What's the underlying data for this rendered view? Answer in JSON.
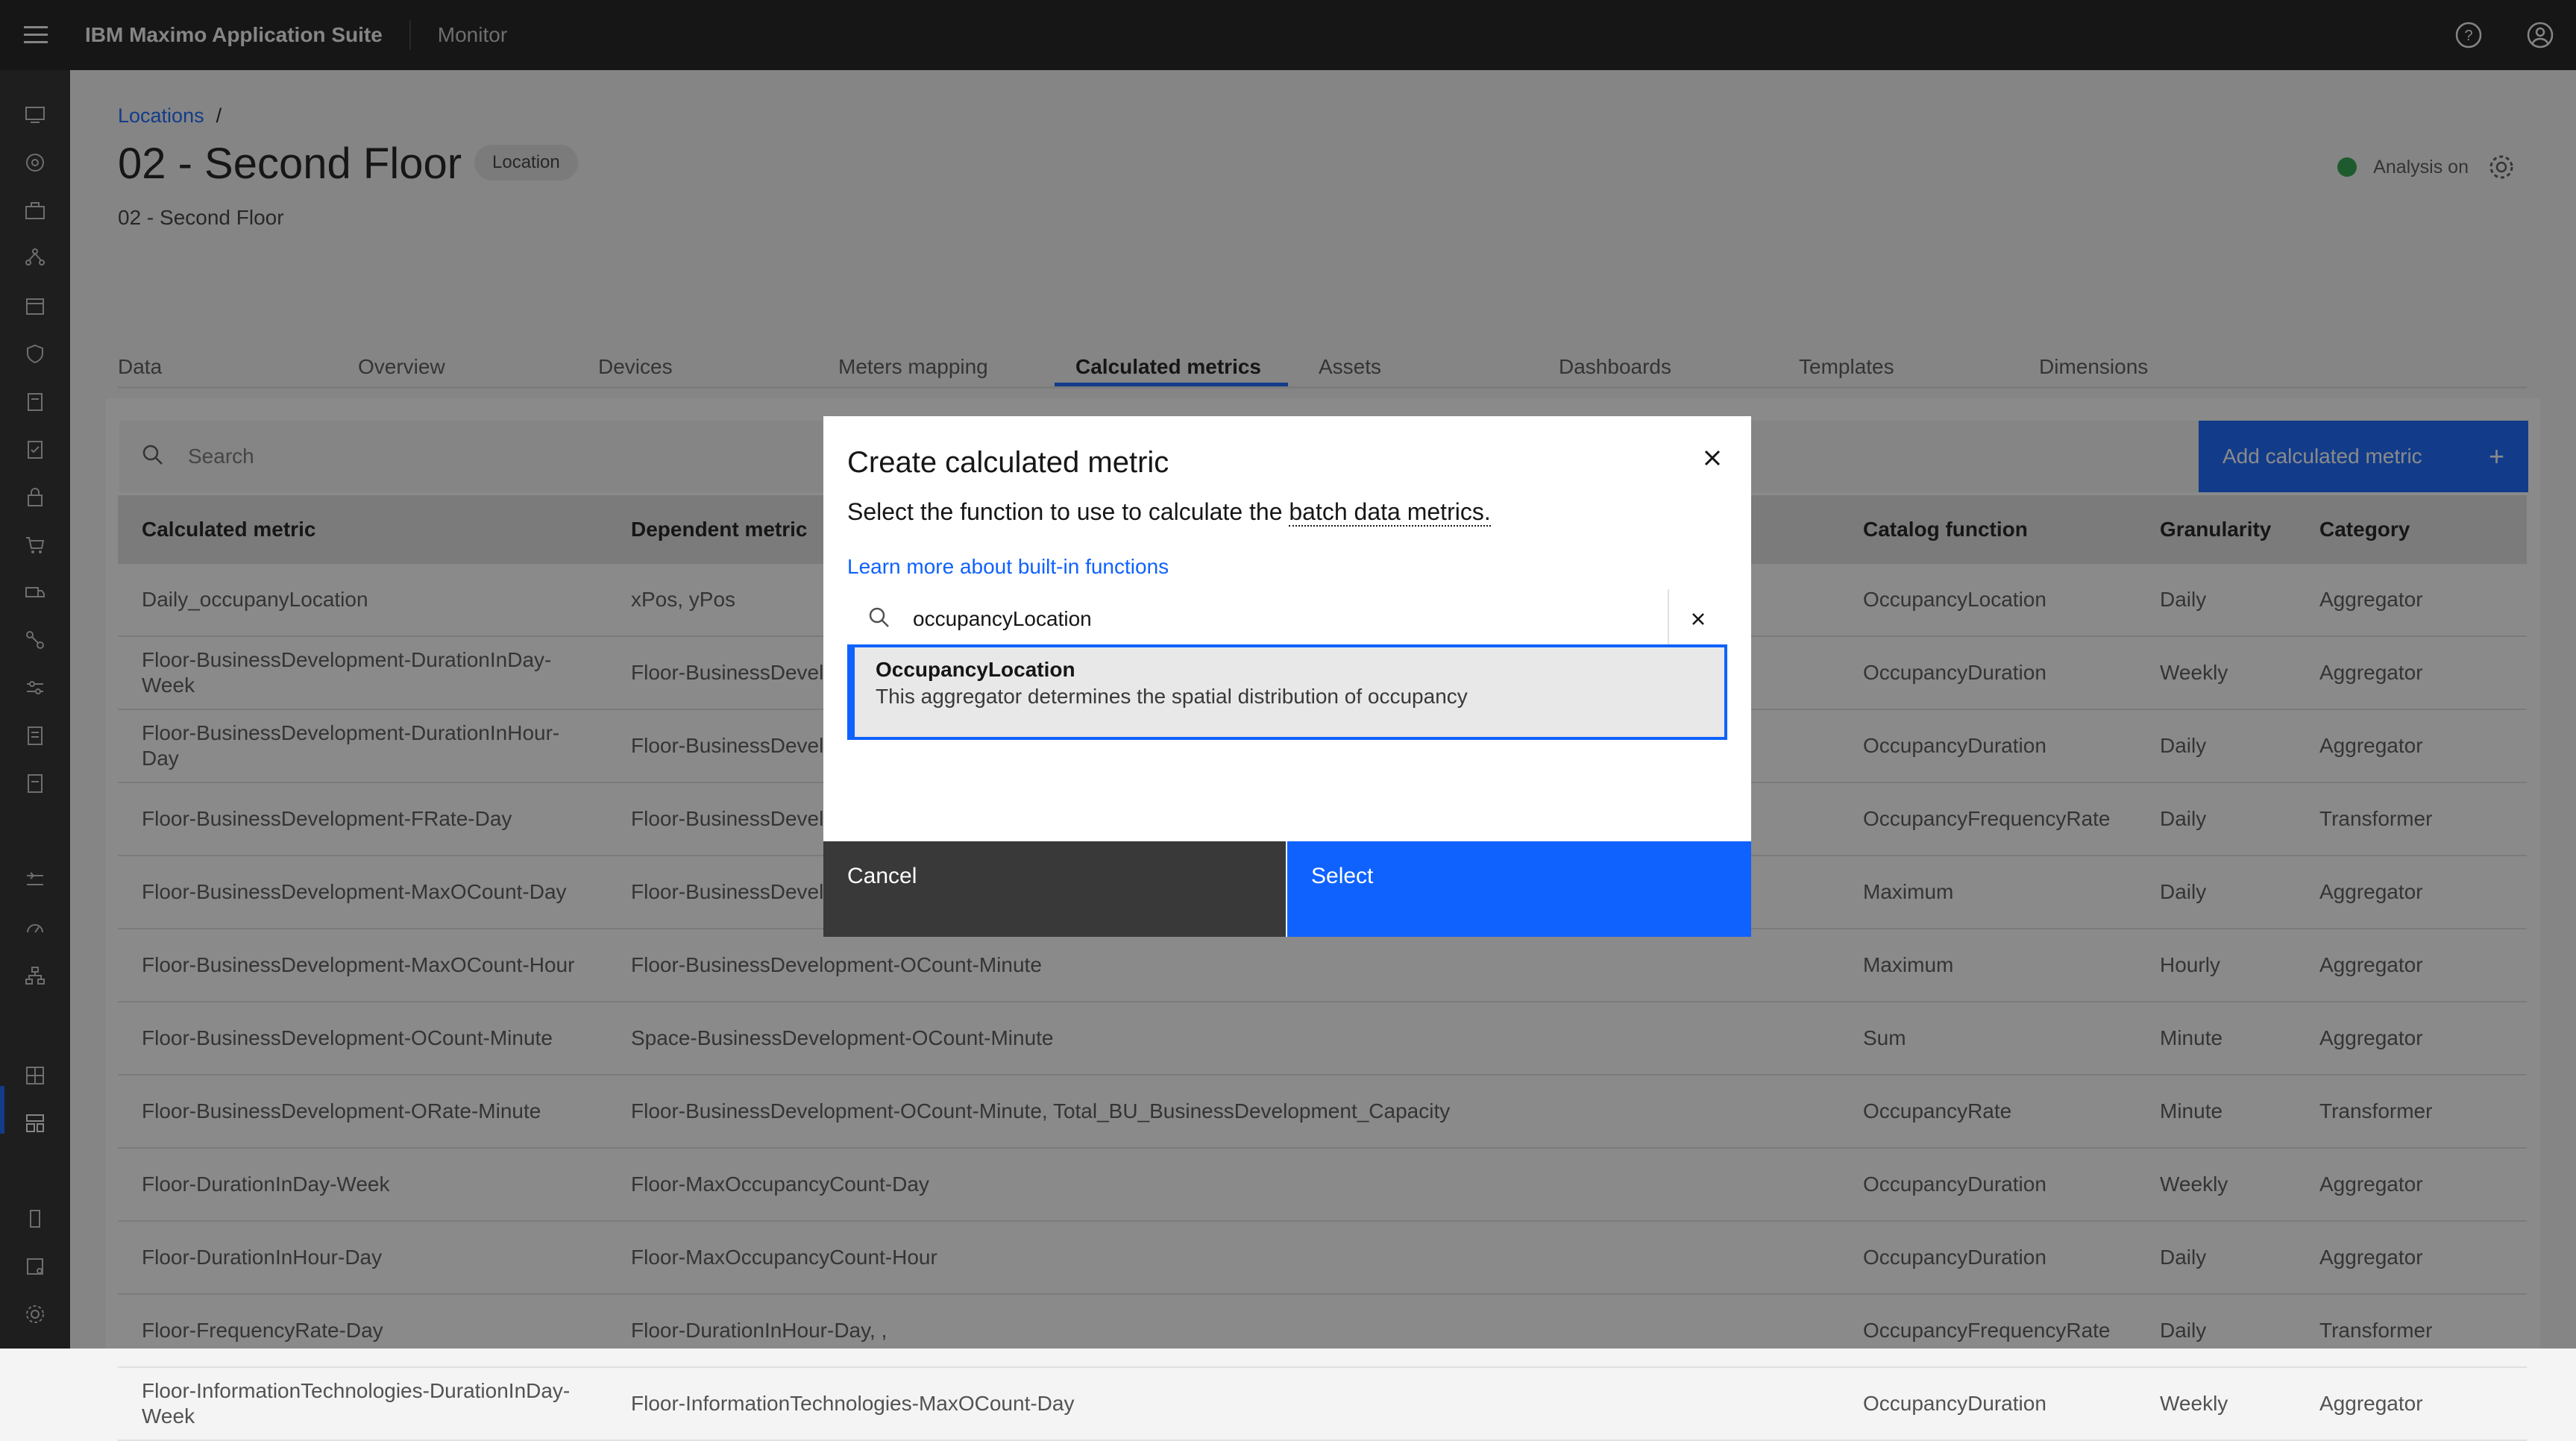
{
  "header": {
    "brand": "IBM Maximo Application Suite",
    "product": "Monitor",
    "icons": [
      "hamburger-menu-icon",
      "help-icon",
      "user-avatar-icon"
    ]
  },
  "sidebar": {
    "icons": [
      "monitor-icon",
      "asset-icon",
      "toolbox-icon",
      "network-icon",
      "calendar-icon",
      "shield-icon",
      "clipboard-icon",
      "checklist-icon",
      "lock-icon",
      "cart-icon",
      "truck-icon",
      "connection-icon",
      "sliders-icon",
      "report-icon",
      "document-icon",
      "settings-adjust-icon",
      "gauge-icon",
      "hierarchy-icon",
      "grid-icon",
      "layout-icon",
      "mobile-icon",
      "tablet-icon",
      "settings-icon"
    ]
  },
  "page": {
    "breadcrumb": "Locations",
    "breadcrumb_sep": "/",
    "title": "02 - Second Floor",
    "tag": "Location",
    "subtitle": "02 - Second Floor",
    "analysis_label": "Analysis on",
    "analysis_color": "#24a148"
  },
  "tabs": [
    "Data",
    "Overview",
    "Devices",
    "Meters mapping",
    "Calculated metrics",
    "Assets",
    "Dashboards",
    "Templates",
    "Dimensions"
  ],
  "active_tab": "Calculated metrics",
  "toolbar": {
    "search_placeholder": "Search",
    "add_label": "Add calculated metric",
    "add_icon": "+"
  },
  "table": {
    "headers": [
      "Calculated metric",
      "Dependent metric",
      "Catalog function",
      "Granularity",
      "Category"
    ],
    "rows": [
      [
        "Daily_occupanyLocation",
        "xPos, yPos",
        "OccupancyLocation",
        "Daily",
        "Aggregator"
      ],
      [
        "Floor-BusinessDevelopment-DurationInDay-Week",
        "Floor-BusinessDevelopment-MaxOCount-Day",
        "OccupancyDuration",
        "Weekly",
        "Aggregator"
      ],
      [
        "Floor-BusinessDevelopment-DurationInHour-Day",
        "Floor-BusinessDevelopment-MaxOCount-Hour",
        "OccupancyDuration",
        "Daily",
        "Aggregator"
      ],
      [
        "Floor-BusinessDevelopment-FRate-Day",
        "Floor-BusinessDevelopment-DurationInHour-Day",
        "OccupancyFrequencyRate",
        "Daily",
        "Transformer"
      ],
      [
        "Floor-BusinessDevelopment-MaxOCount-Day",
        "Floor-BusinessDevelopment-OCount-Minute",
        "Maximum",
        "Daily",
        "Aggregator"
      ],
      [
        "Floor-BusinessDevelopment-MaxOCount-Hour",
        "Floor-BusinessDevelopment-OCount-Minute",
        "Maximum",
        "Hourly",
        "Aggregator"
      ],
      [
        "Floor-BusinessDevelopment-OCount-Minute",
        "Space-BusinessDevelopment-OCount-Minute",
        "Sum",
        "Minute",
        "Aggregator"
      ],
      [
        "Floor-BusinessDevelopment-ORate-Minute",
        "Floor-BusinessDevelopment-OCount-Minute, Total_BU_BusinessDevelopment_Capacity",
        "OccupancyRate",
        "Minute",
        "Transformer"
      ],
      [
        "Floor-DurationInDay-Week",
        "Floor-MaxOccupancyCount-Day",
        "OccupancyDuration",
        "Weekly",
        "Aggregator"
      ],
      [
        "Floor-DurationInHour-Day",
        "Floor-MaxOccupancyCount-Hour",
        "OccupancyDuration",
        "Daily",
        "Aggregator"
      ],
      [
        "Floor-FrequencyRate-Day",
        "Floor-DurationInHour-Day, ,",
        "OccupancyFrequencyRate",
        "Daily",
        "Transformer"
      ],
      [
        "Floor-InformationTechnologies-DurationInDay-Week",
        "Floor-InformationTechnologies-MaxOCount-Day",
        "OccupancyDuration",
        "Weekly",
        "Aggregator"
      ]
    ]
  },
  "modal": {
    "title": "Create calculated metric",
    "desc_prefix": "Select the function to use to calculate the ",
    "desc_term": "batch data metrics.",
    "learn_more": "Learn more about built-in functions",
    "search_value": "occupancyLocation",
    "result_name": "OccupancyLocation",
    "result_desc": "This aggregator determines the spatial distribution of occupancy",
    "cancel_label": "Cancel",
    "select_label": "Select"
  },
  "colors": {
    "accent": "#0f62fe",
    "header_bg": "#161616",
    "cancel_bg": "#393939"
  }
}
